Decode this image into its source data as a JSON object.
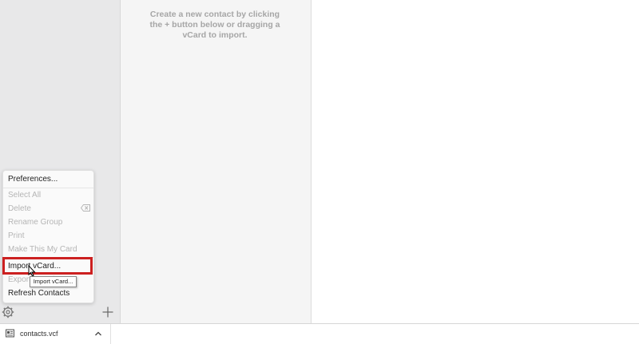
{
  "list_pane": {
    "empty_message": "Create a new contact by clicking the + button below or dragging a vCard to import."
  },
  "action_menu": {
    "preferences": "Preferences...",
    "select_all": "Select All",
    "delete": "Delete",
    "rename_group": "Rename Group",
    "print": "Print",
    "make_this_my_card": "Make This My Card",
    "import_vcard": "Import vCard...",
    "export_vcard": "Export vCard...",
    "refresh_contacts": "Refresh Contacts"
  },
  "tooltip": {
    "text": "Import vCard..."
  },
  "download_bar": {
    "file_name": "contacts.vcf"
  },
  "colors": {
    "highlight_border": "#cc2020",
    "sidebar_bg": "#e8e8e9",
    "list_bg": "#f5f5f5"
  },
  "icons": [
    "gear-icon",
    "plus-icon",
    "delete-backspace-icon",
    "file-icon",
    "chevron-up-icon",
    "cursor-icon"
  ]
}
